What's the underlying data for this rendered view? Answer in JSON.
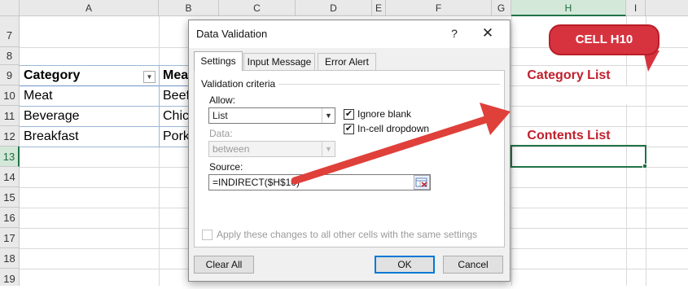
{
  "sheet": {
    "columns": [
      "A",
      "B",
      "C",
      "D",
      "E",
      "F",
      "G",
      "H",
      "I"
    ],
    "rows": [
      "7",
      "8",
      "9",
      "10",
      "11",
      "12",
      "13",
      "14",
      "15",
      "16",
      "17",
      "18",
      "19"
    ],
    "table": {
      "header": [
        "Category",
        "Mea"
      ],
      "rows": [
        [
          "Meat",
          "Beef"
        ],
        [
          "Beverage",
          "Chic"
        ],
        [
          "Breakfast",
          "Pork"
        ]
      ]
    },
    "category_list_label": "Category List",
    "contents_list_label": "Contents List"
  },
  "callout": {
    "text": "CELL H10",
    "color": "#d7333f"
  },
  "dialog": {
    "title": "Data Validation",
    "help": "?",
    "close": "✕",
    "tabs": [
      "Settings",
      "Input Message",
      "Error Alert"
    ],
    "active_tab": "Settings",
    "group_label": "Validation criteria",
    "allow_label": "Allow:",
    "allow_value": "List",
    "data_label": "Data:",
    "data_value": "between",
    "ignore_blank": {
      "label": "Ignore blank",
      "checked": true
    },
    "in_cell_dropdown": {
      "label": "In-cell dropdown",
      "checked": true
    },
    "source_label": "Source:",
    "source_value": "=INDIRECT($H$10)",
    "apply_all": {
      "label": "Apply these changes to all other cells with the same settings",
      "checked": false
    },
    "clear_all": "Clear All",
    "ok": "OK",
    "cancel": "Cancel"
  },
  "colors": {
    "excel_green": "#217346",
    "red_label": "#c0202d",
    "arrow": "#e0403a"
  }
}
